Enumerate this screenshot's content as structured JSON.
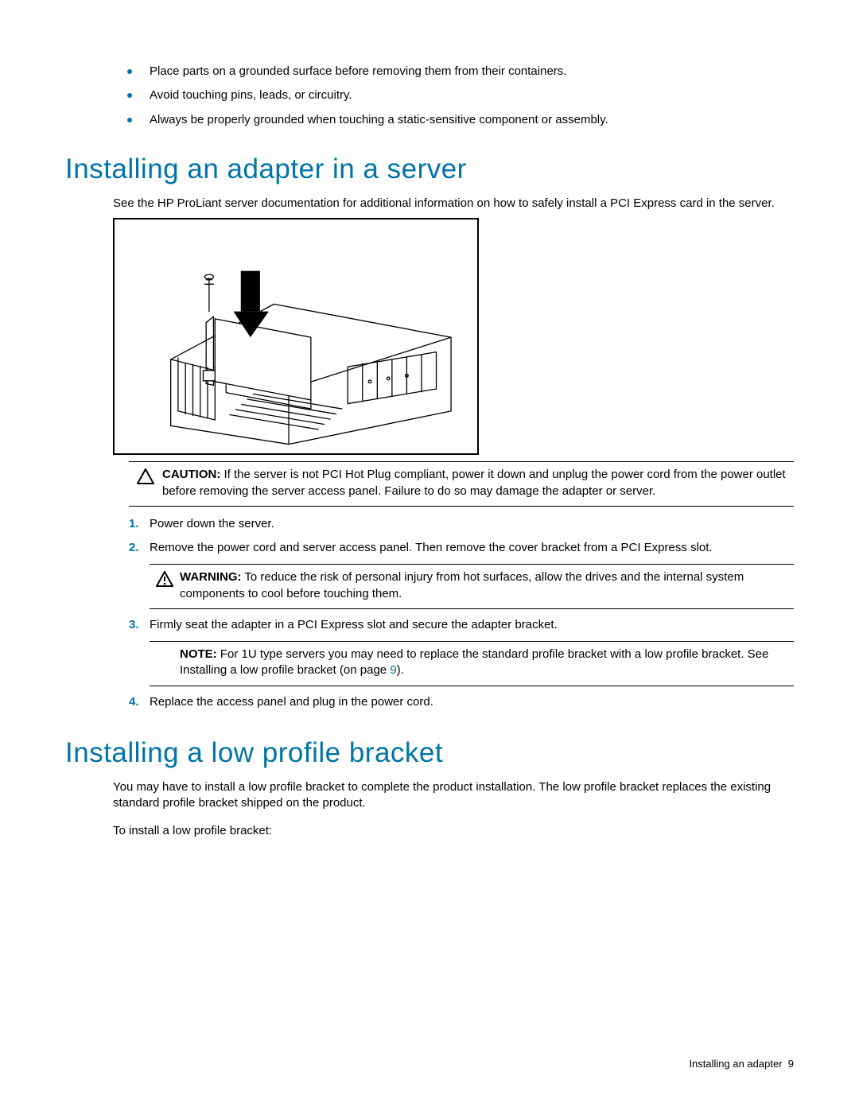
{
  "intro_bullets": [
    "Place parts on a grounded surface before removing them from their containers.",
    "Avoid touching pins, leads, or circuitry.",
    "Always be properly grounded when touching a static-sensitive component or assembly."
  ],
  "section1": {
    "heading": "Installing an adapter in a server",
    "intro": "See the HP ProLiant server documentation for additional information on how to safely install a PCI Express card in the server.",
    "caution": {
      "label": "CAUTION:",
      "text": " If the server is not PCI Hot Plug compliant, power it down and unplug the power cord from the power outlet before removing the server access panel. Failure to do so may damage the adapter or server."
    },
    "steps": {
      "1": "Power down the server.",
      "2": "Remove the power cord and server access panel. Then remove the cover bracket from a PCI Express slot.",
      "3": "Firmly seat the adapter in a PCI Express slot and secure the adapter bracket.",
      "4": "Replace the access panel and plug in the power cord."
    },
    "warning": {
      "label": "WARNING:",
      "text": " To reduce the risk of personal injury from hot surfaces, allow the drives and the internal system components to cool before touching them."
    },
    "note": {
      "label": "NOTE:",
      "text_before": " For 1U type servers you may need to replace the standard profile bracket with a low profile bracket. See Installing a low profile bracket (on page ",
      "link": "9",
      "text_after": ")."
    }
  },
  "section2": {
    "heading": "Installing a low profile bracket",
    "p1": "You may have to install a low profile bracket to complete the product installation. The low profile bracket replaces the existing standard profile bracket shipped on the product.",
    "p2": "To install a low profile bracket:"
  },
  "footer": {
    "title": "Installing an adapter",
    "page": "9"
  }
}
